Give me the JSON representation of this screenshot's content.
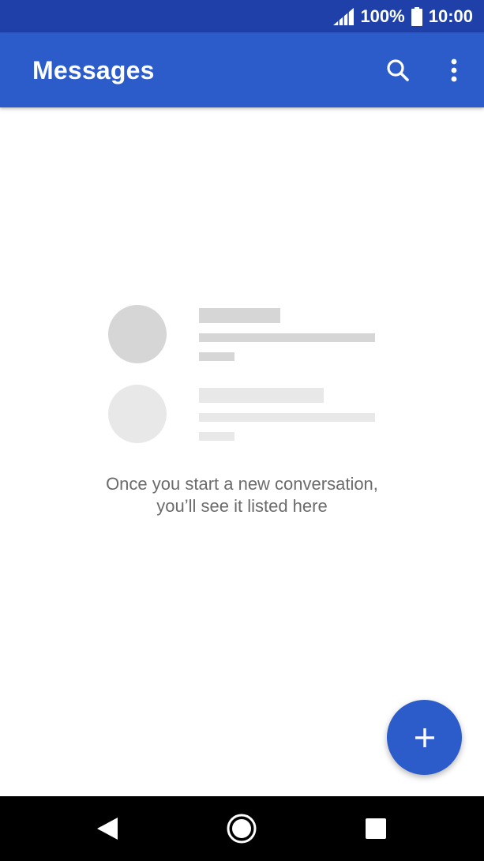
{
  "status_bar": {
    "battery_percent": "100%",
    "time": "10:00",
    "icons": [
      "signal-icon",
      "battery-icon"
    ]
  },
  "app_bar": {
    "title": "Messages",
    "icons": [
      "search-icon",
      "more-vert-icon"
    ]
  },
  "empty_state": {
    "line1": "Once you start a new conversation,",
    "line2": "you’ll see it listed here"
  },
  "fab": {
    "icon": "plus-icon"
  },
  "nav_bar": {
    "icons": [
      "back-icon",
      "home-icon",
      "recents-icon"
    ]
  },
  "colors": {
    "status_bar": "#1e40a8",
    "app_bar": "#2c5cc9",
    "accent": "#2c5cc9",
    "placeholder_dark": "#d6d6d6",
    "placeholder_light": "#e8e8e8",
    "text_secondary": "#6b6b6b"
  }
}
